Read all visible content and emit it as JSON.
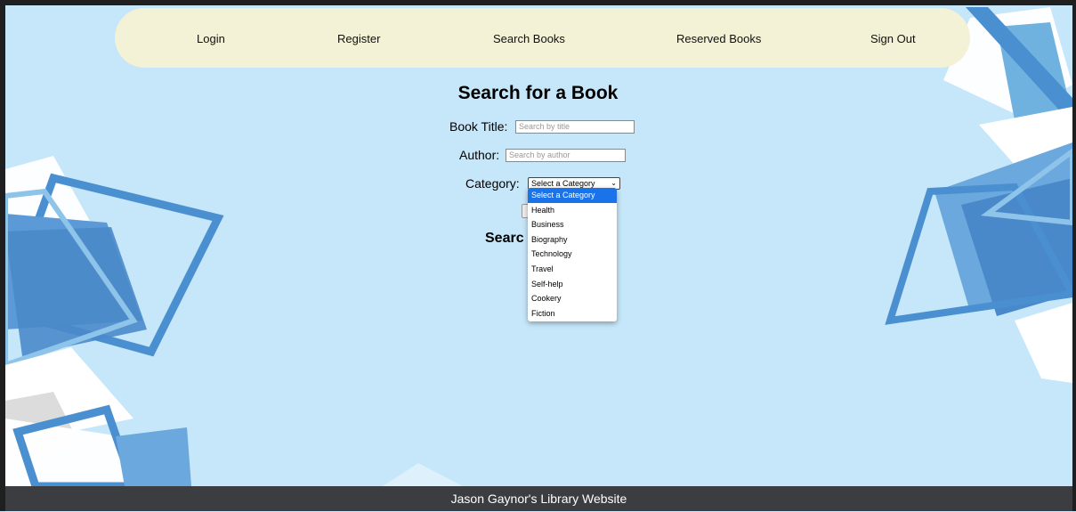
{
  "nav": {
    "items": [
      {
        "label": "Login"
      },
      {
        "label": "Register"
      },
      {
        "label": "Search Books"
      },
      {
        "label": "Reserved Books"
      },
      {
        "label": "Sign Out"
      }
    ]
  },
  "page_title": "Search for a Book",
  "form": {
    "title_label": "Book Title:",
    "title_placeholder": "Search by title",
    "author_label": "Author:",
    "author_placeholder": "Search by author",
    "category_label": "Category:",
    "category_selected": "Select a Category"
  },
  "dropdown_options": [
    "Select a Category",
    "Health",
    "Business",
    "Biography",
    "Technology",
    "Travel",
    "Self-help",
    "Cookery",
    "Fiction"
  ],
  "results_heading": "Searc",
  "footer_text": "Jason Gaynor's Library Website",
  "colors": {
    "background": "#c6e6f9",
    "navbar": "#f3f1d6",
    "footer": "#3b3d40",
    "dropdown_selected": "#1a73e8"
  }
}
